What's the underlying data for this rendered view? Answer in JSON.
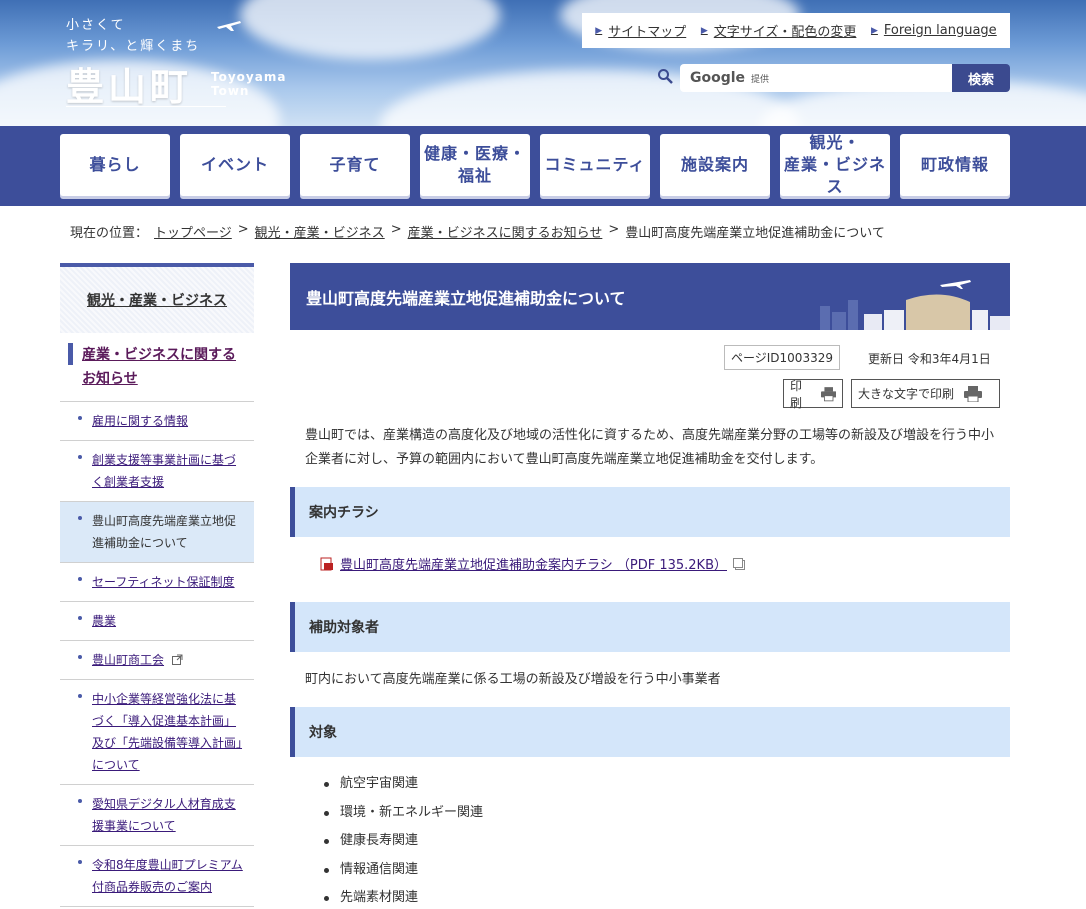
{
  "header": {
    "tagline_1": "小さくて",
    "tagline_2": "キラリ、と輝くまち",
    "town_name": "豊山町",
    "town_name_en_1": "Toyoyama",
    "town_name_en_2": "Town",
    "links": [
      "サイトマップ",
      "文字サイズ・配色の変更",
      "Foreign language"
    ],
    "search_brand": "Google",
    "search_provided": "提供",
    "search_button": "検索"
  },
  "nav": {
    "items": [
      "暮らし",
      "イベント",
      "子育て",
      "健康・医療・\n福祉",
      "コミュニティ",
      "施設案内",
      "観光・\n産業・ビジネス",
      "町政情報"
    ]
  },
  "breadcrumb": {
    "label": "現在の位置：",
    "items": [
      "トップページ",
      "観光・産業・ビジネス",
      "産業・ビジネスに関するお知らせ"
    ],
    "current": "豊山町高度先端産業立地促進補助金について",
    "separator": ">"
  },
  "sidebar": {
    "heading": "観光・産業・ビジネス",
    "current": "産業・ビジネスに関するお知らせ",
    "items": [
      "雇用に関する情報",
      "創業支援等事業計画に基づく創業者支援",
      "豊山町高度先端産業立地促進補助金について",
      "セーフティネット保証制度",
      "農業",
      "豊山町商工会",
      "中小企業等経営強化法に基づく「導入促進基本計画」及び「先端設備等導入計画」について",
      "愛知県デジタル人材育成支援事業について",
      "令和8年度豊山町プレミアム付商品券販売のご案内"
    ]
  },
  "main": {
    "title": "豊山町高度先端産業立地促進補助金について",
    "page_id": "ページID1003329",
    "updated": "更新日 令和3年4月1日",
    "print_label": "印刷",
    "print_large_label": "大きな文字で印刷",
    "lead": "豊山町では、産業構造の高度化及び地域の活性化に資するため、高度先端産業分野の工場等の新設及び増設を行う中小企業者に対し、予算の範囲内において豊山町高度先端産業立地促進補助金を交付します。",
    "section1": "案内チラシ",
    "pdf_link": "豊山町高度先端産業立地促進補助金案内チラシ （PDF 135.2KB）",
    "section2": "補助対象者",
    "target_text": "町内において高度先端産業に係る工場の新設及び増設を行う中小事業者",
    "section3": "対象",
    "targets": [
      "航空宇宙関連",
      "環境・新エネルギー関連",
      "健康長寿関連",
      "情報通信関連",
      "先端素材関連"
    ]
  },
  "colors": {
    "nav_bg": "#3d4e9a",
    "heading_bg": "#d4e6fa",
    "active_bg": "#dbe9f8"
  }
}
